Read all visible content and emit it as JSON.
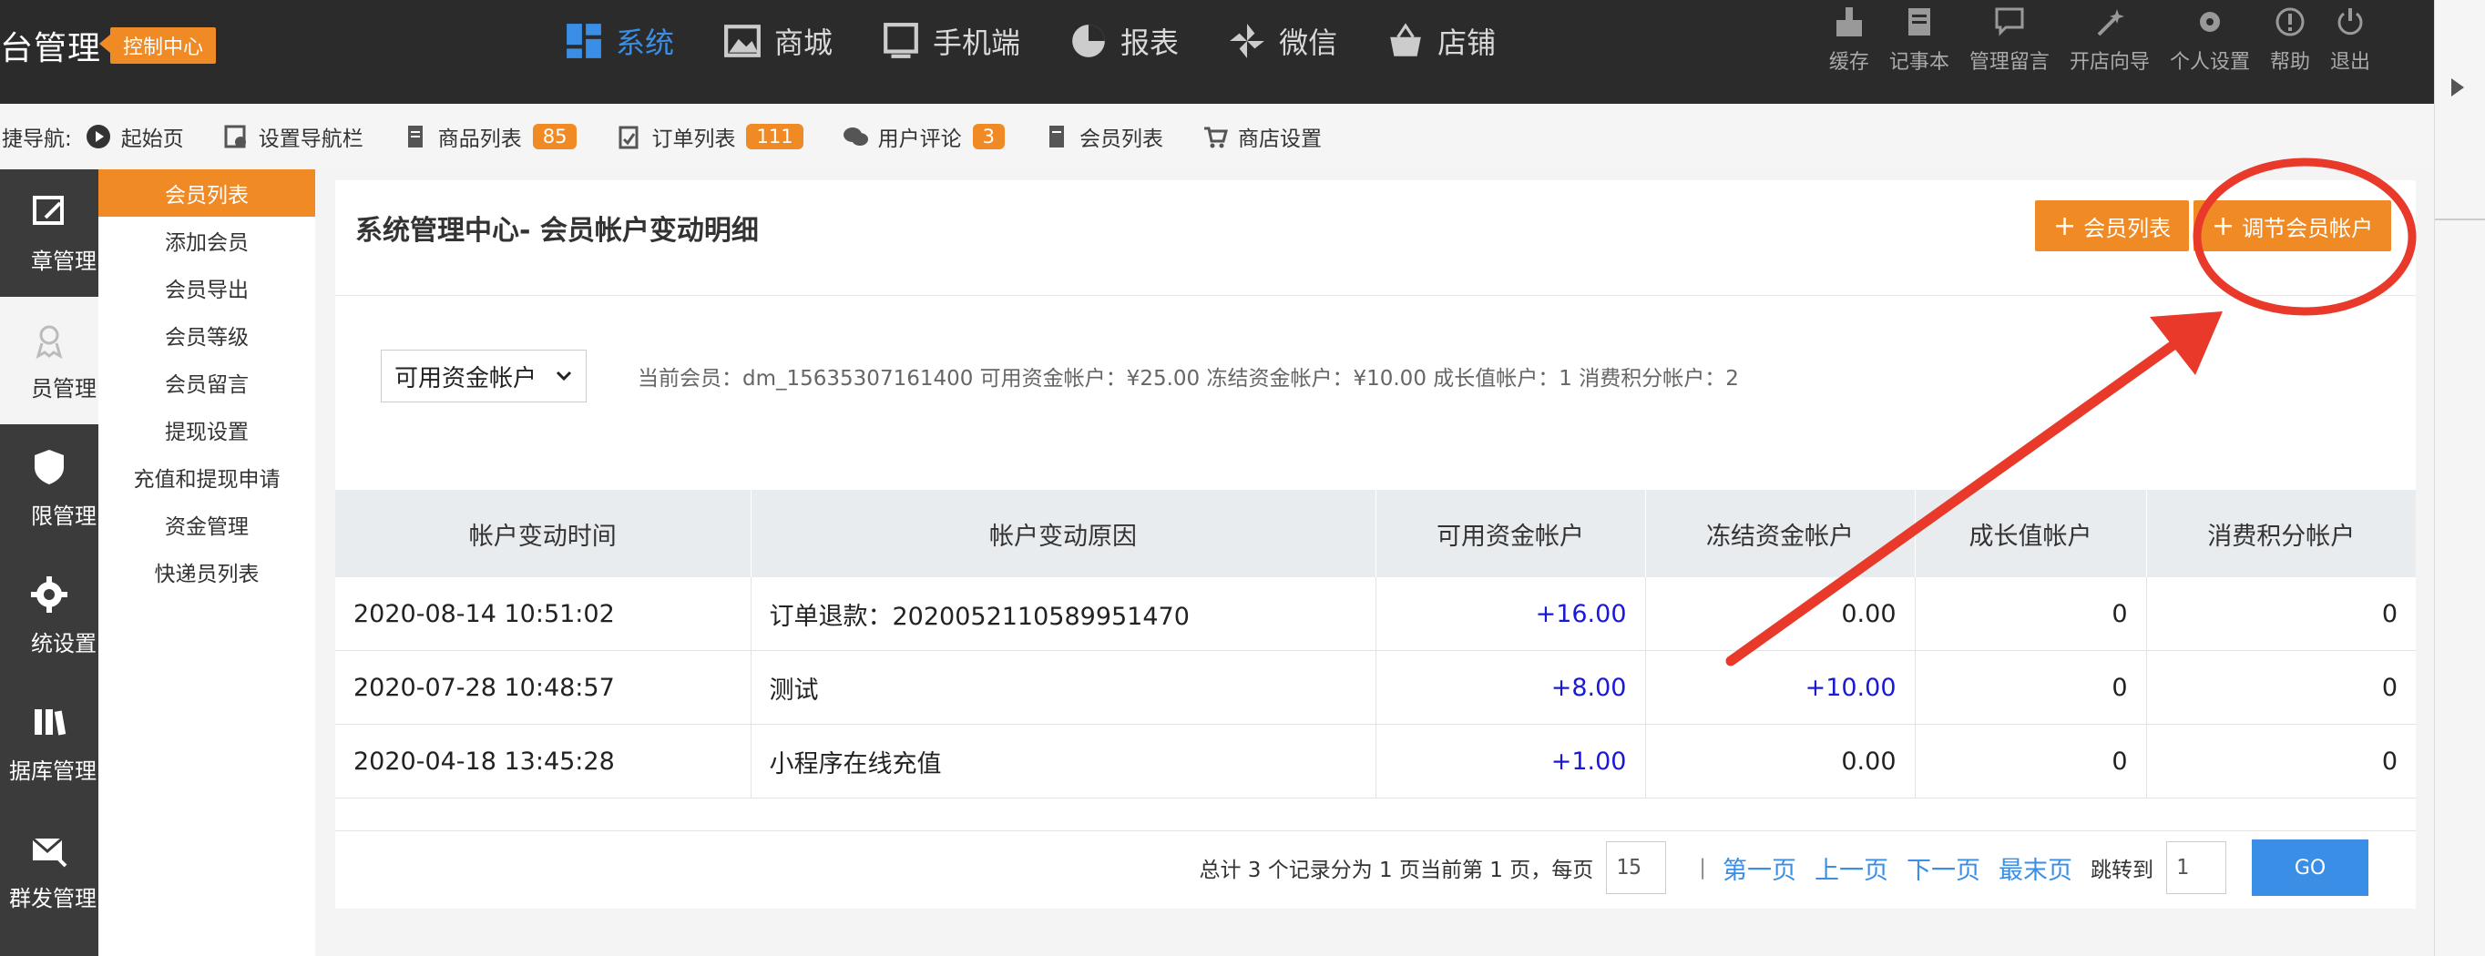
{
  "brand": {
    "title": "台管理",
    "badge": "控制中心"
  },
  "mainnav": [
    {
      "label": "系统",
      "icon": "grid-icon",
      "active": true
    },
    {
      "label": "商城",
      "icon": "image-icon"
    },
    {
      "label": "手机端",
      "icon": "monitor-icon"
    },
    {
      "label": "报表",
      "icon": "pie-chart-icon"
    },
    {
      "label": "微信",
      "icon": "pinwheel-icon"
    },
    {
      "label": "店铺",
      "icon": "basket-icon"
    }
  ],
  "tools": [
    {
      "label": "缓存",
      "icon": "broom-icon"
    },
    {
      "label": "记事本",
      "icon": "notebook-icon"
    },
    {
      "label": "管理留言",
      "icon": "message-icon"
    },
    {
      "label": "开店向导",
      "icon": "wand-icon"
    },
    {
      "label": "个人设置",
      "icon": "gear-icon"
    },
    {
      "label": "帮助",
      "icon": "help-icon"
    },
    {
      "label": "退出",
      "icon": "power-icon"
    }
  ],
  "quicknav": {
    "label": "捷导航:",
    "items": [
      {
        "label": "起始页",
        "icon": "play-circle-icon"
      },
      {
        "label": "设置导航栏",
        "icon": "settings-page-icon"
      },
      {
        "label": "商品列表",
        "icon": "document-icon",
        "badge": "85"
      },
      {
        "label": "订单列表",
        "icon": "order-icon",
        "badge": "111"
      },
      {
        "label": "用户评论",
        "icon": "comment-icon",
        "badge": "3"
      },
      {
        "label": "会员列表",
        "icon": "member-doc-icon"
      },
      {
        "label": "商店设置",
        "icon": "cart-icon"
      }
    ]
  },
  "iconbar": [
    {
      "label": "章管理",
      "icon": "article-icon"
    },
    {
      "label": "员管理",
      "icon": "member-icon",
      "active": true
    },
    {
      "label": "限管理",
      "icon": "shield-icon"
    },
    {
      "label": "统设置",
      "icon": "gear-icon"
    },
    {
      "label": "据库管理",
      "icon": "database-icon"
    },
    {
      "label": "群发管理",
      "icon": "mail-icon"
    }
  ],
  "submenu": [
    "会员列表",
    "添加会员",
    "会员导出",
    "会员等级",
    "会员留言",
    "提现设置",
    "充值和提现申请",
    "资金管理",
    "快递员列表"
  ],
  "page": {
    "title": "系统管理中心- 会员帐户变动明细",
    "btn_member_list": "会员列表",
    "btn_adjust": "调节会员帐户",
    "account_select": "可用资金帐户",
    "summary": "当前会员：dm_15635307161400 可用资金帐户：¥25.00 冻结资金帐户：¥10.00 成长值帐户：1 消费积分帐户：2"
  },
  "table": {
    "headers": [
      "帐户变动时间",
      "帐户变动原因",
      "可用资金帐户",
      "冻结资金帐户",
      "成长值帐户",
      "消费积分帐户"
    ],
    "rows": [
      [
        "2020-08-14 10:51:02",
        "订单退款：2020052110589951470",
        "+16.00",
        "0.00",
        "0",
        "0"
      ],
      [
        "2020-07-28 10:48:57",
        "测试",
        "+8.00",
        "+10.00",
        "0",
        "0"
      ],
      [
        "2020-04-18 13:45:28",
        "小程序在线充值",
        "+1.00",
        "0.00",
        "0",
        "0"
      ]
    ]
  },
  "pager": {
    "summary": "总计 3 个记录分为 1 页当前第 1 页，每页",
    "per_page": "15",
    "sep": "|",
    "first": "第一页",
    "prev": "上一页",
    "next": "下一页",
    "last": "最末页",
    "jump_label": "跳转到",
    "jump_value": "1",
    "go": "GO"
  },
  "colors": {
    "accent": "#f08a24",
    "link": "#3a8ee6",
    "topbar": "#2b2b2b",
    "annotation": "#e8392a"
  }
}
